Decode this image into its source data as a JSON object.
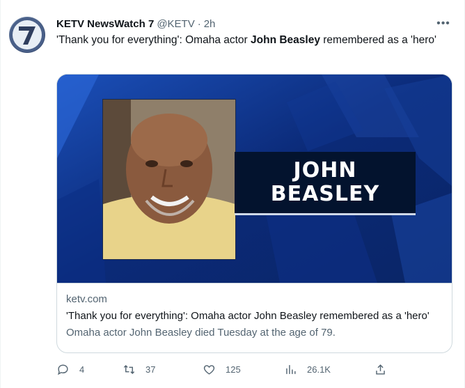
{
  "tweet": {
    "display_name": "KETV NewsWatch 7",
    "handle": "@KETV",
    "separator": "·",
    "time": "2h",
    "more_label": "•••",
    "text_part1": "'Thank you for everything': Omaha actor ",
    "text_bold": "John Beasley",
    "text_part2": " remembered as a 'hero'"
  },
  "card": {
    "name_line1": "JOHN",
    "name_line2": "BEASLEY",
    "domain": "ketv.com",
    "title": "'Thank you for everything': Omaha actor John Beasley remembered as a 'hero'",
    "description": "Omaha actor John Beasley died Tuesday at the age of 79."
  },
  "actions": {
    "replies": "4",
    "retweets": "37",
    "likes": "125",
    "views": "26.1K"
  },
  "colors": {
    "secondary_text": "#536471",
    "card_border": "#cfd9de",
    "card_background": "#0a2260"
  }
}
